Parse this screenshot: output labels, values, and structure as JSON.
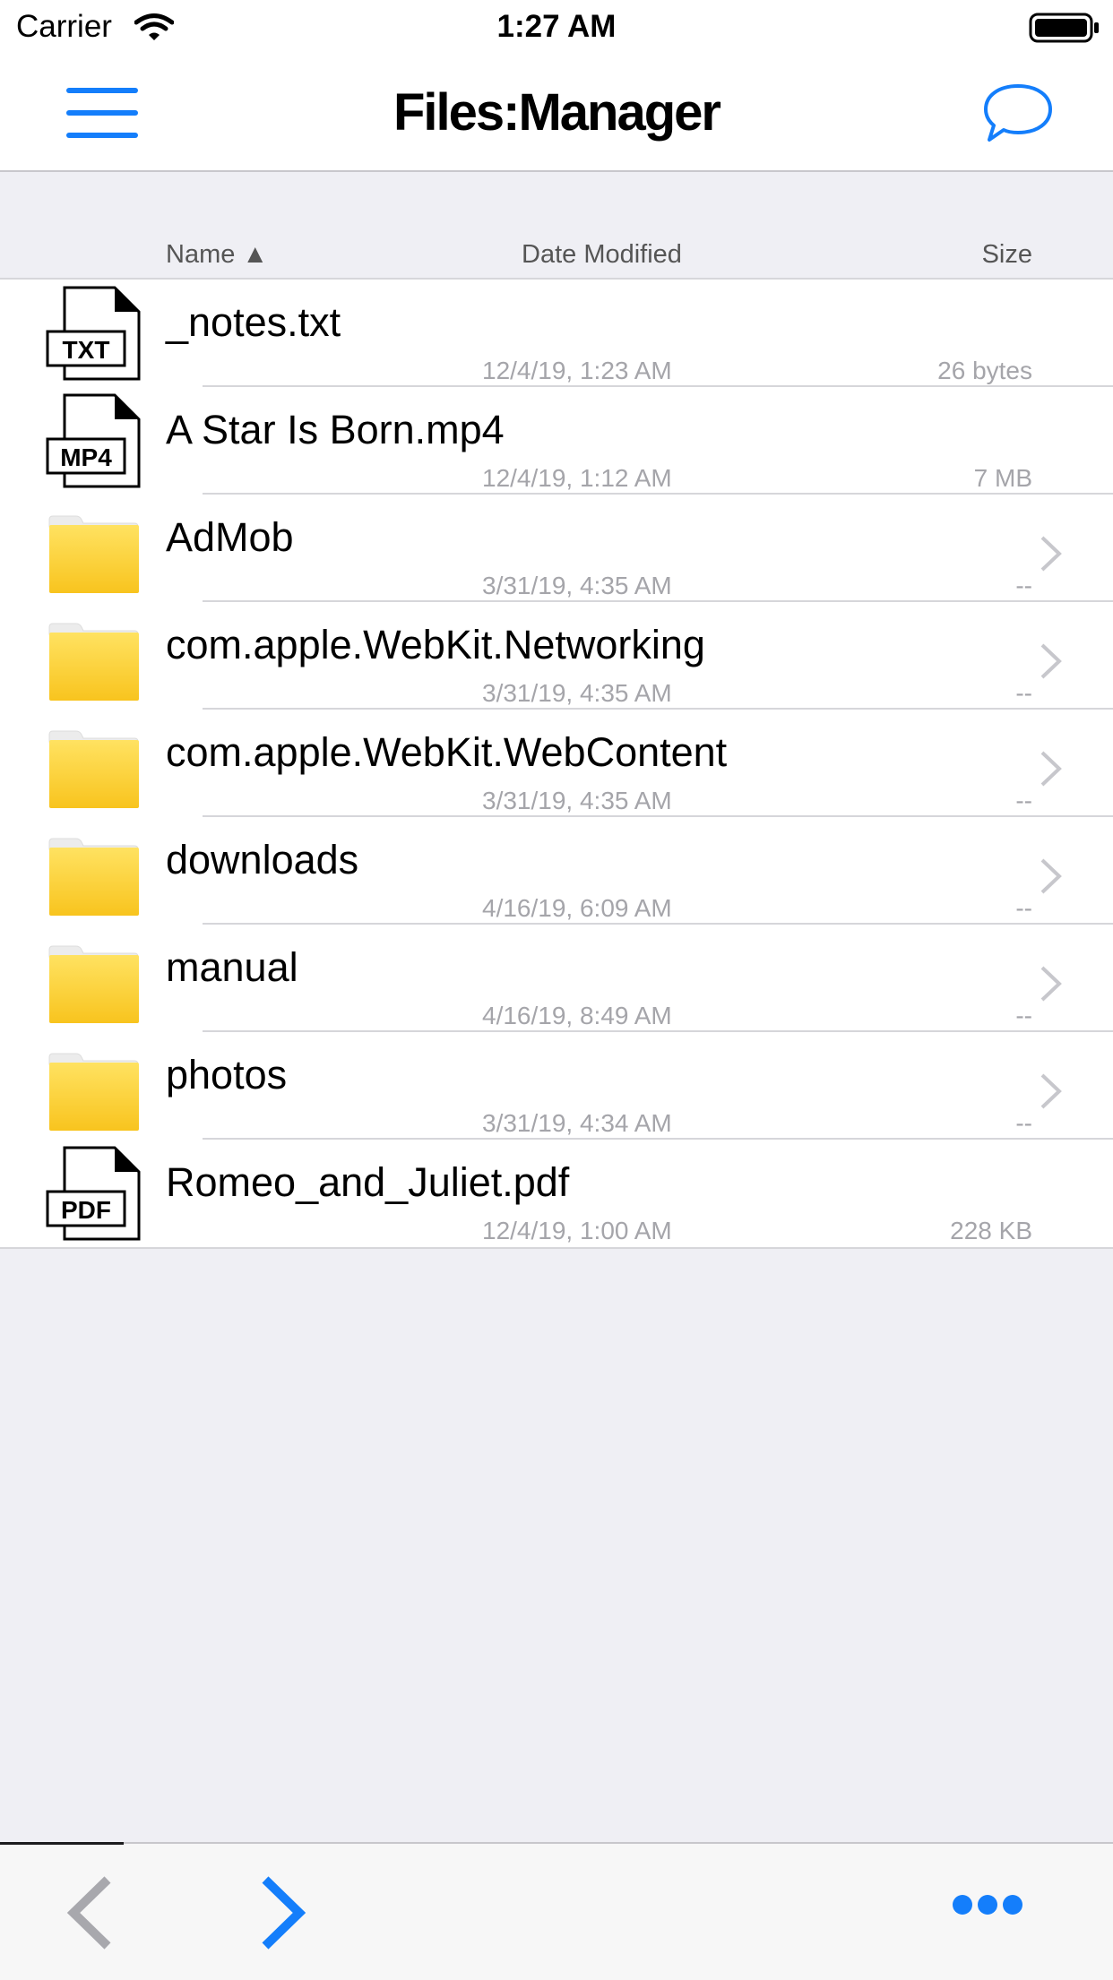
{
  "status_bar": {
    "carrier": "Carrier",
    "time": "1:27 AM"
  },
  "nav": {
    "title": "Files:Manager",
    "menu_icon": "hamburger-menu-icon",
    "chat_icon": "chat-bubble-icon"
  },
  "columns": {
    "name": "Name ▲",
    "date": "Date Modified",
    "size": "Size"
  },
  "colors": {
    "accent": "#147efb",
    "folder_top": "#ffe261",
    "folder_bottom": "#f8c41e",
    "secondary_text": "#a5a5aa"
  },
  "files": [
    {
      "name": "_notes.txt",
      "date": "12/4/19, 1:23 AM",
      "size": "26 bytes",
      "type": "file",
      "badge": "TXT"
    },
    {
      "name": "A Star Is Born.mp4",
      "date": "12/4/19, 1:12 AM",
      "size": "7 MB",
      "type": "file",
      "badge": "MP4"
    },
    {
      "name": "AdMob",
      "date": "3/31/19, 4:35 AM",
      "size": "--",
      "type": "folder"
    },
    {
      "name": "com.apple.WebKit.Networking",
      "date": "3/31/19, 4:35 AM",
      "size": "--",
      "type": "folder"
    },
    {
      "name": "com.apple.WebKit.WebContent",
      "date": "3/31/19, 4:35 AM",
      "size": "--",
      "type": "folder"
    },
    {
      "name": "downloads",
      "date": "4/16/19, 6:09 AM",
      "size": "--",
      "type": "folder"
    },
    {
      "name": "manual",
      "date": "4/16/19, 8:49 AM",
      "size": "--",
      "type": "folder"
    },
    {
      "name": "photos",
      "date": "3/31/19, 4:34 AM",
      "size": "--",
      "type": "folder"
    },
    {
      "name": "Romeo_and_Juliet.pdf",
      "date": "12/4/19, 1:00 AM",
      "size": "228 KB",
      "type": "file",
      "badge": "PDF"
    }
  ],
  "toolbar": {
    "back_icon": "chevron-left-icon",
    "forward_icon": "chevron-right-icon",
    "more_icon": "more-dots-icon"
  }
}
